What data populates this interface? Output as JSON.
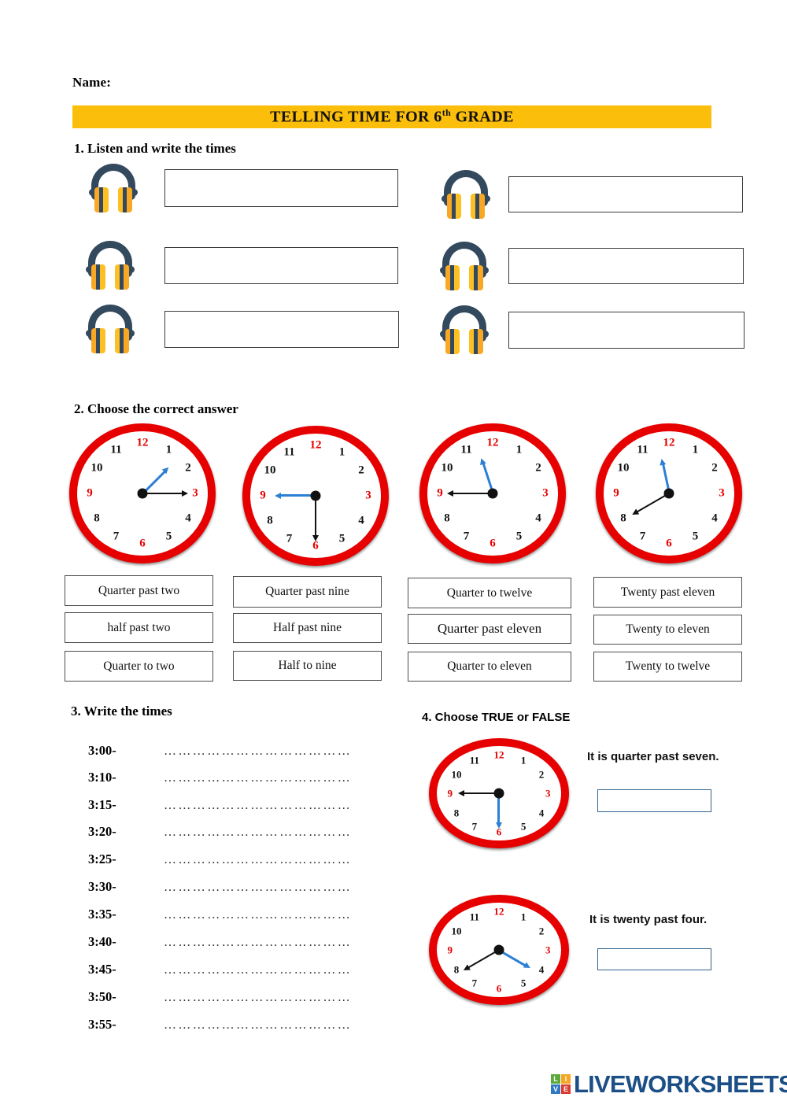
{
  "header": {
    "name_label": "Name:",
    "title_main": "TELLING TIME FOR 6",
    "title_sup": "th",
    "title_tail": " GRADE",
    "banner_color": "#FBBE0B"
  },
  "section1": {
    "heading": "1.  Listen and write the times",
    "icon": "headphones-icon",
    "items": [
      {
        "id": "listen-1",
        "value": "",
        "placeholder": ""
      },
      {
        "id": "listen-2",
        "value": "",
        "placeholder": ""
      },
      {
        "id": "listen-3",
        "value": "",
        "placeholder": ""
      },
      {
        "id": "listen-4",
        "value": "",
        "placeholder": ""
      },
      {
        "id": "listen-5",
        "value": "",
        "placeholder": ""
      },
      {
        "id": "listen-6",
        "value": "",
        "placeholder": ""
      }
    ]
  },
  "section2": {
    "heading": "2.  Choose the correct answer",
    "clock_numbers": [
      "12",
      "1",
      "2",
      "3",
      "4",
      "5",
      "6",
      "7",
      "8",
      "9",
      "10",
      "11"
    ],
    "clock_red_numbers": [
      "12",
      "3",
      "6",
      "9"
    ],
    "colors": {
      "rim": "#e60000",
      "hand_hour": "#111111",
      "hand_minute": "#2b7fd4"
    },
    "clocks": [
      {
        "id": "clock-1",
        "black_hand_points_to": 3,
        "blue_hand_points_to": 1.5
      },
      {
        "id": "clock-2",
        "black_hand_points_to": 6,
        "blue_hand_points_to": 9
      },
      {
        "id": "clock-3",
        "black_hand_points_to": 9,
        "blue_hand_points_to": 11.4
      },
      {
        "id": "clock-4",
        "black_hand_points_to": 8,
        "blue_hand_points_to": 11.6
      }
    ],
    "option_groups": [
      {
        "group": "group-1",
        "options": [
          "Quarter past two",
          "half past two",
          "Quarter to two"
        ]
      },
      {
        "group": "group-2",
        "options": [
          "Quarter past nine",
          "Half past nine",
          "Half to nine"
        ]
      },
      {
        "group": "group-3",
        "options": [
          "Quarter to twelve",
          "Quarter past eleven",
          "Quarter to eleven"
        ]
      },
      {
        "group": "group-4",
        "options": [
          "Twenty past eleven",
          "Twenty to eleven",
          "Twenty to twelve"
        ]
      }
    ]
  },
  "section3": {
    "heading": "3.  Write the times",
    "dots": "…………………………………",
    "times": [
      "3:00-",
      "3:10-",
      "3:15-",
      "3:20-",
      "3:25-",
      "3:30-",
      "3:35-",
      "3:40-",
      "3:45-",
      "3:50-",
      "3:55-"
    ]
  },
  "section4": {
    "heading": "4. Choose TRUE or FALSE",
    "items": [
      {
        "id": "tf-1",
        "statement": "It is quarter past seven.",
        "clock": {
          "black_hand_points_to": 9,
          "blue_hand_points_to": 6
        },
        "answer": "",
        "placeholder": ""
      },
      {
        "id": "tf-2",
        "statement": "It is twenty past four.",
        "clock": {
          "black_hand_points_to": 8,
          "blue_hand_points_to": 4
        },
        "answer": "",
        "placeholder": ""
      }
    ]
  },
  "footer": {
    "logo_tiles": [
      "L",
      "I",
      "V",
      "E"
    ],
    "wordmark": "LIVEWORKSHEETS",
    "tile_colors": [
      "#5aab3c",
      "#f5a623",
      "#2f78c4",
      "#d93b31"
    ],
    "wordmark_color": "#1b4f86"
  }
}
